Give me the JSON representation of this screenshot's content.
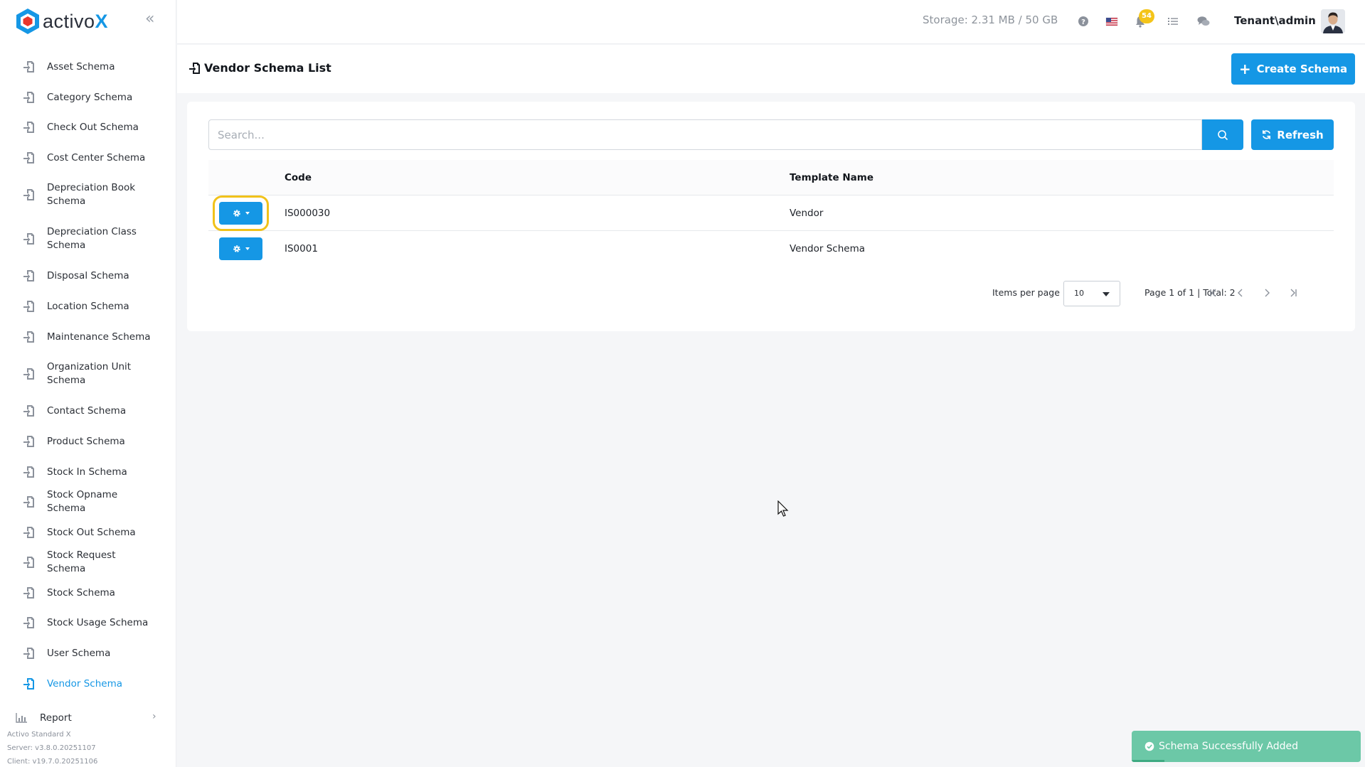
{
  "app": {
    "logo_text": "activo",
    "logo_x": "X"
  },
  "sidebar": {
    "items": [
      {
        "label": "Asset Schema"
      },
      {
        "label": "Category Schema"
      },
      {
        "label": "Check Out Schema"
      },
      {
        "label": "Cost Center Schema"
      },
      {
        "label": "Depreciation Book Schema"
      },
      {
        "label": "Depreciation Class Schema"
      },
      {
        "label": "Disposal Schema"
      },
      {
        "label": "Location Schema"
      },
      {
        "label": "Maintenance Schema"
      },
      {
        "label": "Organization Unit Schema"
      },
      {
        "label": "Contact Schema"
      },
      {
        "label": "Product Schema"
      },
      {
        "label": "Stock In Schema"
      },
      {
        "label": "Stock Opname Schema"
      },
      {
        "label": "Stock Out Schema"
      },
      {
        "label": "Stock Request Schema"
      },
      {
        "label": "Stock Schema"
      },
      {
        "label": "Stock Usage Schema"
      },
      {
        "label": "User Schema"
      },
      {
        "label": "Vendor Schema"
      }
    ],
    "active_index": 19,
    "report_label": "Report",
    "versions": {
      "edition": "Activo Standard X",
      "server": "Server: v3.8.0.20251107",
      "client": "Client: v19.7.0.20251106"
    }
  },
  "header": {
    "storage": "Storage: 2.31 MB / 50 GB",
    "notification_count": "54",
    "user": "Tenant\\admin",
    "icons": [
      "help-icon",
      "us-flag-icon",
      "bell-icon",
      "task-list-icon",
      "chat-icon"
    ]
  },
  "page": {
    "title": "Vendor Schema List",
    "create_button": "Create Schema"
  },
  "search": {
    "placeholder": "Search...",
    "refresh_label": "Refresh"
  },
  "table": {
    "columns": [
      "",
      "Code",
      "Template Name"
    ],
    "rows": [
      {
        "code": "IS000030",
        "template_name": "Vendor"
      },
      {
        "code": "IS0001",
        "template_name": "Vendor Schema"
      }
    ]
  },
  "pagination": {
    "items_per_page_label": "Items per page",
    "items_per_page_value": "10",
    "page_info": "Page 1 of 1 | Total: 2"
  },
  "toast": {
    "message": "Schema Successfully Added"
  },
  "colors": {
    "primary": "#1597e5",
    "highlight": "#f1c21a",
    "toast": "#6cc8a7",
    "badge": "#f4c419"
  }
}
